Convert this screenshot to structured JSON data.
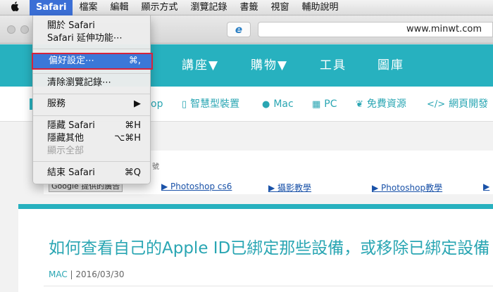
{
  "menubar": {
    "apple_icon": "apple-logo-icon",
    "items": [
      "Safari",
      "檔案",
      "編輯",
      "顯示方式",
      "瀏覽記錄",
      "書籤",
      "視窗",
      "輔助說明"
    ]
  },
  "toolbar": {
    "ie_icon": "e",
    "url": "www.minwt.com"
  },
  "site_nav": {
    "items": [
      "講座▼",
      "購物▼",
      "工具",
      "圖庫"
    ]
  },
  "category_nav": {
    "items": [
      {
        "icon": "mobile-icon",
        "glyph": "▯",
        "label": "智慧型裝置"
      },
      {
        "icon": "apple-icon",
        "glyph": "●",
        "label": "Mac"
      },
      {
        "icon": "windows-icon",
        "glyph": "▦",
        "label": "PC"
      },
      {
        "icon": "leaf-icon",
        "glyph": "❦",
        "label": "免費資源"
      },
      {
        "icon": "code-icon",
        "glyph": "</>",
        "label": "網頁開發"
      }
    ],
    "partial_text": "op"
  },
  "ads": {
    "partial_header": "號",
    "choice_label": "Google 提供的廣告",
    "links": [
      "▶ Photoshop cs6",
      "▶ 攝影教學",
      "▶ Photoshop教學",
      "▶"
    ]
  },
  "article": {
    "title": "如何查看自己的Apple ID已綁定那些設備，或移除已綁定設備",
    "category": "MAC",
    "date": " | 2016/03/30"
  },
  "safari_menu": {
    "items": [
      {
        "label": "關於 Safari",
        "shortcut": ""
      },
      {
        "label": "Safari 延伸功能⋯",
        "shortcut": ""
      },
      {
        "label": "偏好設定⋯",
        "shortcut": "⌘,"
      },
      {
        "label": "清除瀏覽記錄⋯",
        "shortcut": ""
      },
      {
        "label": "服務",
        "shortcut": "▶"
      },
      {
        "label": "隱藏 Safari",
        "shortcut": "⌘H"
      },
      {
        "label": "隱藏其他",
        "shortcut": "⌥⌘H"
      },
      {
        "label": "顯示全部",
        "shortcut": ""
      },
      {
        "label": "結束 Safari",
        "shortcut": "⌘Q"
      }
    ]
  },
  "colors": {
    "teal": "#27b1bf",
    "menu_highlight": "#3b78d8",
    "callout_border": "#d3243c"
  }
}
